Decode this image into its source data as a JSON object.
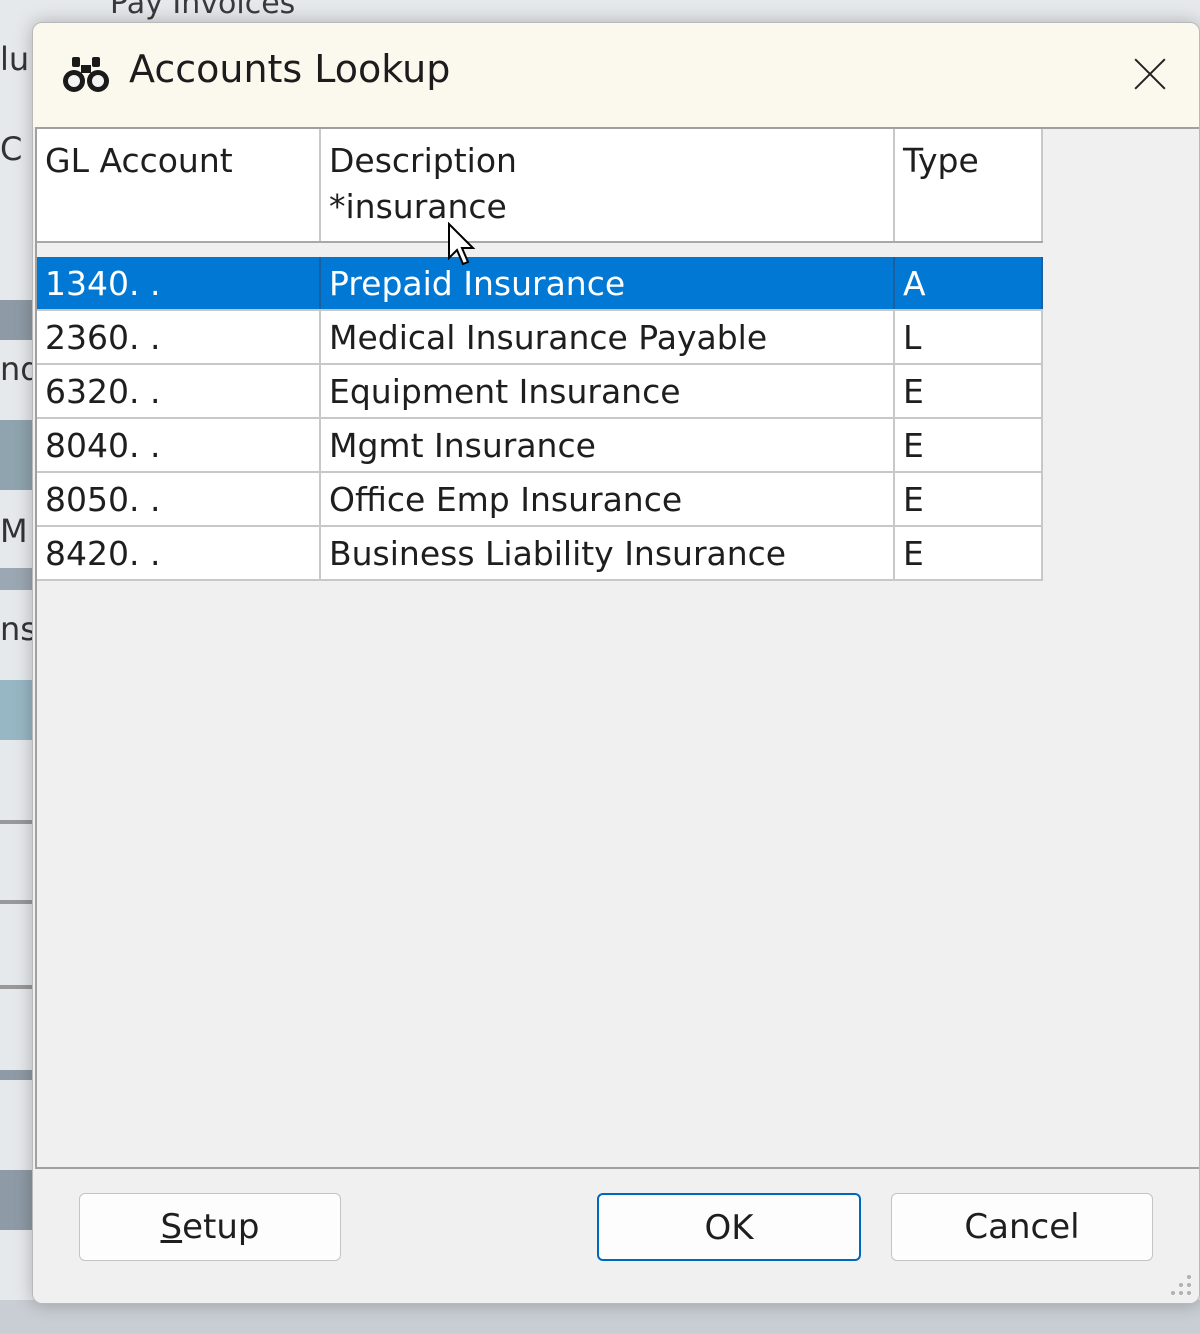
{
  "background": {
    "top_text": "Pay Invoices",
    "left_fragments": [
      "lu",
      "C",
      "nd",
      "M",
      "ns"
    ]
  },
  "dialog": {
    "title": "Accounts Lookup",
    "title_icon": "binoculars-icon",
    "close_icon": "close-icon"
  },
  "grid": {
    "columns": [
      {
        "title": "GL Account",
        "filter": ""
      },
      {
        "title": "Description",
        "filter": "*insurance"
      },
      {
        "title": "Type",
        "filter": ""
      }
    ],
    "rows": [
      {
        "account": "1340.  .",
        "description": "Prepaid Insurance",
        "type": "A",
        "selected": true
      },
      {
        "account": "2360.  .",
        "description": "Medical Insurance Payable",
        "type": "L",
        "selected": false
      },
      {
        "account": "6320.  .",
        "description": "Equipment Insurance",
        "type": "E",
        "selected": false
      },
      {
        "account": "8040.  .",
        "description": "Mgmt Insurance",
        "type": "E",
        "selected": false
      },
      {
        "account": "8050.  .",
        "description": "Office Emp Insurance",
        "type": "E",
        "selected": false
      },
      {
        "account": "8420.  .",
        "description": "Business Liability Insurance",
        "type": "E",
        "selected": false
      }
    ]
  },
  "buttons": {
    "setup_first": "S",
    "setup_rest": "etup",
    "ok": "OK",
    "cancel": "Cancel"
  },
  "colors": {
    "selection": "#0078d4",
    "title_bg": "#fbf8ee",
    "ok_border": "#0067c0"
  }
}
